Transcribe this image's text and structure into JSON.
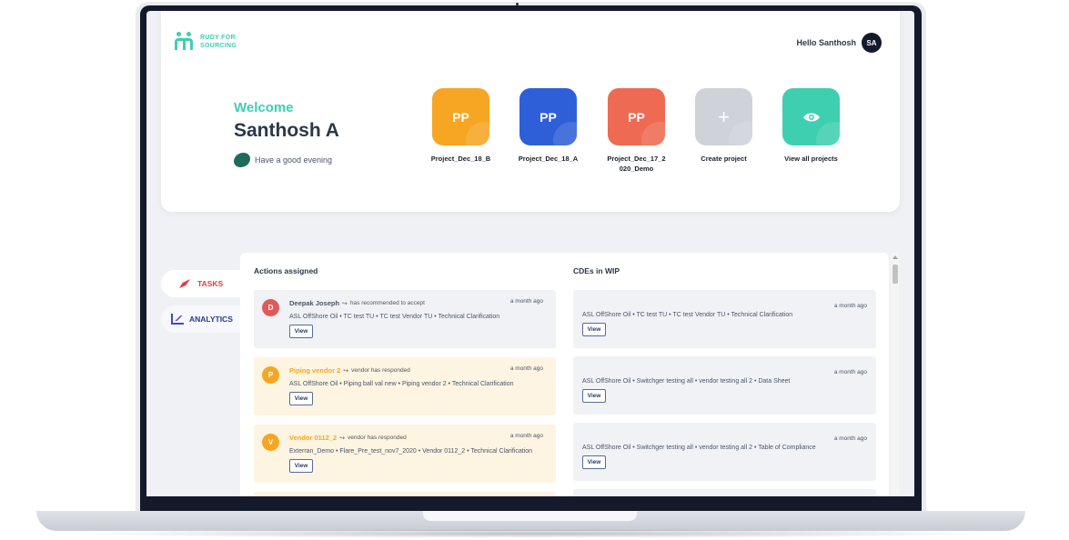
{
  "brand": {
    "line1": "RUDY FOR",
    "line2": "SOURCING"
  },
  "user": {
    "greeting": "Hello Santhosh",
    "initials": "SA"
  },
  "hero": {
    "welcome": "Welcome",
    "name": "Santhosh A",
    "message": "Have a good evening"
  },
  "projects": [
    {
      "abbr": "PP",
      "label": "Project_Dec_18_B",
      "color": "#f6a623"
    },
    {
      "abbr": "PP",
      "label": "Project_Dec_18_A",
      "color": "#2f5fd8"
    },
    {
      "abbr": "PP",
      "label": "Project_Dec_17_2\n020_Demo",
      "color": "#ee6a52"
    }
  ],
  "quick_actions": {
    "create": {
      "symbol": "+",
      "label": "Create project",
      "color": "#cfd2d9"
    },
    "view_all": {
      "icon": "eye-icon",
      "label": "View all projects",
      "color": "#3ecfb0"
    }
  },
  "side_nav": {
    "tasks": "TASKS",
    "analytics": "ANALYTICS"
  },
  "actions": {
    "title": "Actions assigned",
    "items": [
      {
        "initial": "D",
        "avatar_color": "#e05a5a",
        "name": "Deepak Joseph",
        "action": "has recommended to accept",
        "time": "a month ago",
        "path": "ASL OffShore Oil • TC test TU • TC test Vendor TU • Technical Clarification",
        "button": "View",
        "style": "grey"
      },
      {
        "initial": "P",
        "avatar_color": "#f6a623",
        "name": "Piping vendor 2",
        "action": "vendor has responded",
        "time": "a month ago",
        "path": "ASL OffShore Oil • Piping ball val new • Piping vendor 2 • Technical Clarification",
        "button": "View",
        "style": "yellow"
      },
      {
        "initial": "V",
        "avatar_color": "#f6a623",
        "name": "Vendor 0112_2",
        "action": "vendor has responded",
        "time": "a month ago",
        "path": "Exterran_Demo • Flare_Pre_test_nov7_2020 • Vendor 0112_2 • Technical Clarification",
        "button": "View",
        "style": "yellow"
      }
    ]
  },
  "cdes": {
    "title": "CDEs in WIP",
    "items": [
      {
        "time": "a month ago",
        "path": "ASL OffShore Oil • TC test TU • TC test Vendor TU • Technical Clarification",
        "button": "View"
      },
      {
        "time": "a month ago",
        "path": "ASL OffShore Oil • Switchger testing all • vendor testing all 2 • Data Sheet",
        "button": "View"
      },
      {
        "time": "a month ago",
        "path": "ASL OffShore Oil • Switchger testing all • vendor testing all 2 • Table of Compliance",
        "button": "View"
      }
    ]
  }
}
